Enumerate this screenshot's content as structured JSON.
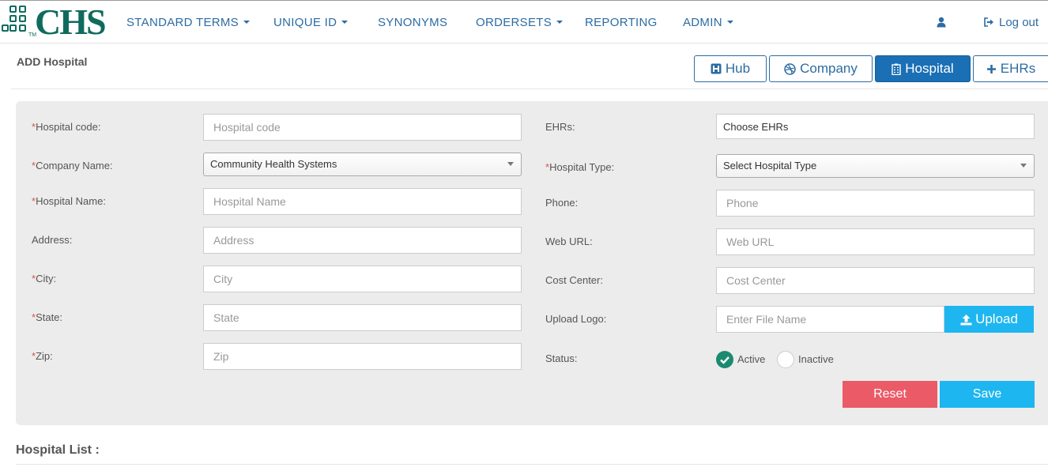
{
  "brand": {
    "logo_text": "CHS",
    "logo_tm": "TM"
  },
  "nav": {
    "items": [
      {
        "label": "STANDARD TERMS",
        "dropdown": true
      },
      {
        "label": "UNIQUE ID",
        "dropdown": true
      },
      {
        "label": "SYNONYMS",
        "dropdown": false
      },
      {
        "label": "ORDERSETS",
        "dropdown": true
      },
      {
        "label": "REPORTING",
        "dropdown": false
      },
      {
        "label": "ADMIN",
        "dropdown": true
      }
    ],
    "user_icon": "user-icon",
    "logout_label": "Log out",
    "logout_icon": "sign-out-icon"
  },
  "page": {
    "title": "ADD Hospital",
    "tabs": [
      {
        "label": "Hub",
        "icon": "hospital-h-icon",
        "active": false
      },
      {
        "label": "Company",
        "icon": "dribbble-icon",
        "active": false
      },
      {
        "label": "Hospital",
        "icon": "building-icon",
        "active": true
      },
      {
        "label": "EHRs",
        "icon": "plus-icon",
        "active": false
      }
    ]
  },
  "form": {
    "required_mark": "*",
    "hospital_code": {
      "label": "Hospital code:",
      "placeholder": "Hospital code",
      "value": ""
    },
    "company_name": {
      "label": "Company Name:",
      "value": "Community Health Systems"
    },
    "hospital_name": {
      "label": "Hospital Name:",
      "placeholder": "Hospital Name",
      "value": ""
    },
    "address": {
      "label": "Address:",
      "placeholder": "Address",
      "value": ""
    },
    "city": {
      "label": "City:",
      "placeholder": "City",
      "value": ""
    },
    "state": {
      "label": "State:",
      "placeholder": "State",
      "value": ""
    },
    "zip": {
      "label": "Zip:",
      "placeholder": "Zip",
      "value": ""
    },
    "ehrs": {
      "label": "EHRs:",
      "value": "Choose EHRs"
    },
    "hospital_type": {
      "label": "Hospital Type:",
      "value": "Select Hospital Type"
    },
    "phone": {
      "label": "Phone:",
      "placeholder": "Phone",
      "value": ""
    },
    "web_url": {
      "label": "Web URL:",
      "placeholder": "Web URL",
      "value": ""
    },
    "cost_center": {
      "label": "Cost Center:",
      "placeholder": "Cost Center",
      "value": ""
    },
    "upload_logo": {
      "label": "Upload Logo:",
      "placeholder": "Enter File Name",
      "button": "Upload"
    },
    "status": {
      "label": "Status:",
      "options": [
        "Active",
        "Inactive"
      ],
      "selected": "Active"
    },
    "reset_label": "Reset",
    "save_label": "Save"
  },
  "list": {
    "title": "Hospital List :"
  },
  "colors": {
    "brand": "#0f6b5e",
    "nav_text": "#2c6ca3",
    "active_tab": "#1a6fb5",
    "primary": "#1eb6f0",
    "danger": "#eb5a67",
    "required": "#d9534f",
    "panel": "#ececec"
  }
}
